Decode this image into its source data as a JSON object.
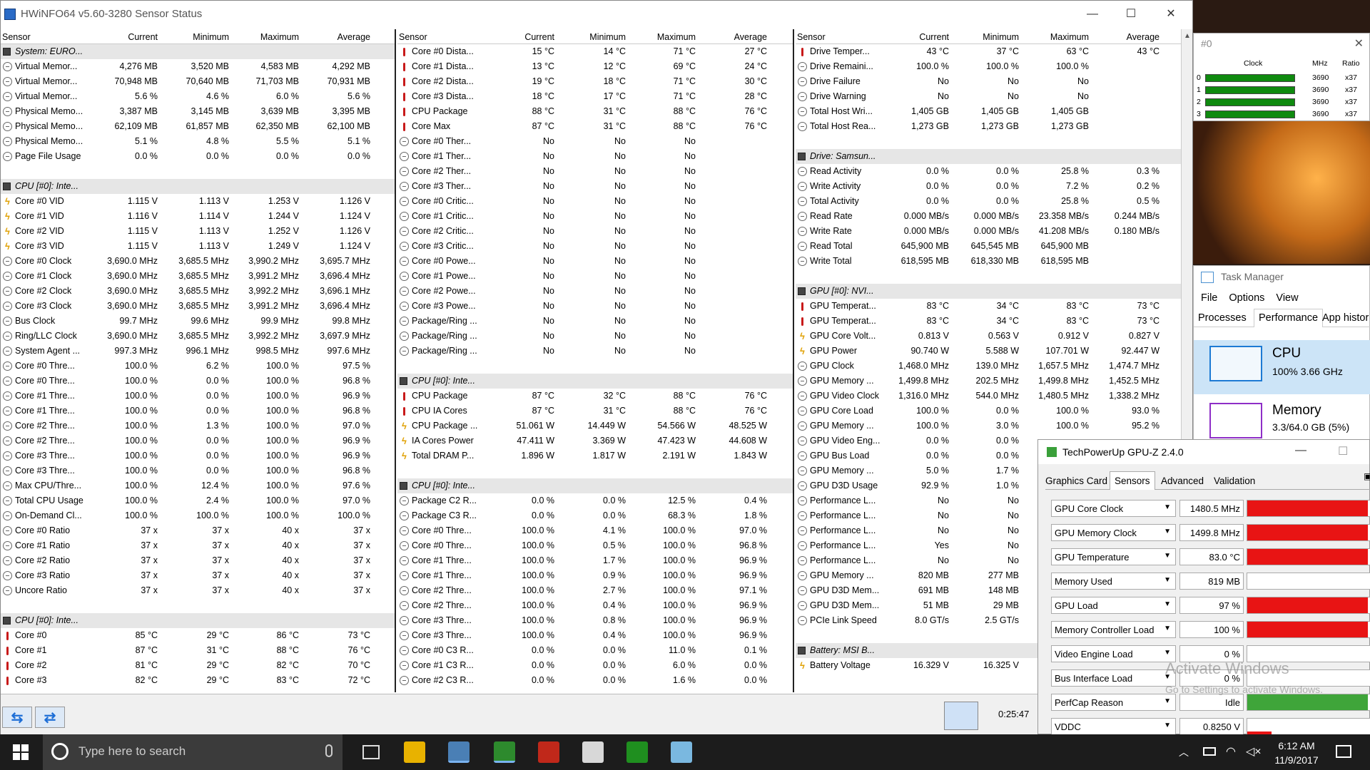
{
  "window": {
    "title": "HWiNFO64 v5.60-3280 Sensor Status",
    "minimize": "—",
    "maximize": "☐",
    "close": "✕"
  },
  "headers": {
    "sensor": "Sensor",
    "current": "Current",
    "minimum": "Minimum",
    "maximum": "Maximum",
    "average": "Average"
  },
  "col1": [
    {
      "t": "grp",
      "n": "System: EURO..."
    },
    {
      "i": "circ",
      "n": "Virtual Memor...",
      "c": "4,276 MB",
      "mn": "3,520 MB",
      "mx": "4,583 MB",
      "av": "4,292 MB"
    },
    {
      "i": "circ",
      "n": "Virtual Memor...",
      "c": "70,948 MB",
      "mn": "70,640 MB",
      "mx": "71,703 MB",
      "av": "70,931 MB"
    },
    {
      "i": "circ",
      "n": "Virtual Memor...",
      "c": "5.6 %",
      "mn": "4.6 %",
      "mx": "6.0 %",
      "av": "5.6 %"
    },
    {
      "i": "circ",
      "n": "Physical Memo...",
      "c": "3,387 MB",
      "mn": "3,145 MB",
      "mx": "3,639 MB",
      "av": "3,395 MB"
    },
    {
      "i": "circ",
      "n": "Physical Memo...",
      "c": "62,109 MB",
      "mn": "61,857 MB",
      "mx": "62,350 MB",
      "av": "62,100 MB"
    },
    {
      "i": "circ",
      "n": "Physical Memo...",
      "c": "5.1 %",
      "mn": "4.8 %",
      "mx": "5.5 %",
      "av": "5.1 %"
    },
    {
      "i": "circ",
      "n": "Page File Usage",
      "c": "0.0 %",
      "mn": "0.0 %",
      "mx": "0.0 %",
      "av": "0.0 %"
    },
    {
      "t": "blank"
    },
    {
      "t": "grp",
      "n": "CPU [#0]: Inte..."
    },
    {
      "i": "bolt",
      "n": "Core #0 VID",
      "c": "1.115 V",
      "mn": "1.113 V",
      "mx": "1.253 V",
      "av": "1.126 V"
    },
    {
      "i": "bolt",
      "n": "Core #1 VID",
      "c": "1.116 V",
      "mn": "1.114 V",
      "mx": "1.244 V",
      "av": "1.124 V"
    },
    {
      "i": "bolt",
      "n": "Core #2 VID",
      "c": "1.115 V",
      "mn": "1.113 V",
      "mx": "1.252 V",
      "av": "1.126 V"
    },
    {
      "i": "bolt",
      "n": "Core #3 VID",
      "c": "1.115 V",
      "mn": "1.113 V",
      "mx": "1.249 V",
      "av": "1.124 V"
    },
    {
      "i": "circ",
      "n": "Core #0 Clock",
      "c": "3,690.0 MHz",
      "mn": "3,685.5 MHz",
      "mx": "3,990.2 MHz",
      "av": "3,695.7 MHz"
    },
    {
      "i": "circ",
      "n": "Core #1 Clock",
      "c": "3,690.0 MHz",
      "mn": "3,685.5 MHz",
      "mx": "3,991.2 MHz",
      "av": "3,696.4 MHz"
    },
    {
      "i": "circ",
      "n": "Core #2 Clock",
      "c": "3,690.0 MHz",
      "mn": "3,685.5 MHz",
      "mx": "3,992.2 MHz",
      "av": "3,696.1 MHz"
    },
    {
      "i": "circ",
      "n": "Core #3 Clock",
      "c": "3,690.0 MHz",
      "mn": "3,685.5 MHz",
      "mx": "3,991.2 MHz",
      "av": "3,696.4 MHz"
    },
    {
      "i": "circ",
      "n": "Bus Clock",
      "c": "99.7 MHz",
      "mn": "99.6 MHz",
      "mx": "99.9 MHz",
      "av": "99.8 MHz"
    },
    {
      "i": "circ",
      "n": "Ring/LLC Clock",
      "c": "3,690.0 MHz",
      "mn": "3,685.5 MHz",
      "mx": "3,992.2 MHz",
      "av": "3,697.9 MHz"
    },
    {
      "i": "circ",
      "n": "System Agent ...",
      "c": "997.3 MHz",
      "mn": "996.1 MHz",
      "mx": "998.5 MHz",
      "av": "997.6 MHz"
    },
    {
      "i": "circ",
      "n": "Core #0 Thre...",
      "c": "100.0 %",
      "mn": "6.2 %",
      "mx": "100.0 %",
      "av": "97.5 %"
    },
    {
      "i": "circ",
      "n": "Core #0 Thre...",
      "c": "100.0 %",
      "mn": "0.0 %",
      "mx": "100.0 %",
      "av": "96.8 %"
    },
    {
      "i": "circ",
      "n": "Core #1 Thre...",
      "c": "100.0 %",
      "mn": "0.0 %",
      "mx": "100.0 %",
      "av": "96.9 %"
    },
    {
      "i": "circ",
      "n": "Core #1 Thre...",
      "c": "100.0 %",
      "mn": "0.0 %",
      "mx": "100.0 %",
      "av": "96.8 %"
    },
    {
      "i": "circ",
      "n": "Core #2 Thre...",
      "c": "100.0 %",
      "mn": "1.3 %",
      "mx": "100.0 %",
      "av": "97.0 %"
    },
    {
      "i": "circ",
      "n": "Core #2 Thre...",
      "c": "100.0 %",
      "mn": "0.0 %",
      "mx": "100.0 %",
      "av": "96.9 %"
    },
    {
      "i": "circ",
      "n": "Core #3 Thre...",
      "c": "100.0 %",
      "mn": "0.0 %",
      "mx": "100.0 %",
      "av": "96.9 %"
    },
    {
      "i": "circ",
      "n": "Core #3 Thre...",
      "c": "100.0 %",
      "mn": "0.0 %",
      "mx": "100.0 %",
      "av": "96.8 %"
    },
    {
      "i": "circ",
      "n": "Max CPU/Thre...",
      "c": "100.0 %",
      "mn": "12.4 %",
      "mx": "100.0 %",
      "av": "97.6 %"
    },
    {
      "i": "circ",
      "n": "Total CPU Usage",
      "c": "100.0 %",
      "mn": "2.4 %",
      "mx": "100.0 %",
      "av": "97.0 %"
    },
    {
      "i": "circ",
      "n": "On-Demand Cl...",
      "c": "100.0 %",
      "mn": "100.0 %",
      "mx": "100.0 %",
      "av": "100.0 %"
    },
    {
      "i": "circ",
      "n": "Core #0 Ratio",
      "c": "37 x",
      "mn": "37 x",
      "mx": "40 x",
      "av": "37 x"
    },
    {
      "i": "circ",
      "n": "Core #1 Ratio",
      "c": "37 x",
      "mn": "37 x",
      "mx": "40 x",
      "av": "37 x"
    },
    {
      "i": "circ",
      "n": "Core #2 Ratio",
      "c": "37 x",
      "mn": "37 x",
      "mx": "40 x",
      "av": "37 x"
    },
    {
      "i": "circ",
      "n": "Core #3 Ratio",
      "c": "37 x",
      "mn": "37 x",
      "mx": "40 x",
      "av": "37 x"
    },
    {
      "i": "circ",
      "n": "Uncore Ratio",
      "c": "37 x",
      "mn": "37 x",
      "mx": "40 x",
      "av": "37 x"
    },
    {
      "t": "blank"
    },
    {
      "t": "grp",
      "n": "CPU [#0]: Inte..."
    },
    {
      "i": "therm",
      "n": "Core #0",
      "c": "85 °C",
      "mn": "29 °C",
      "mx": "86 °C",
      "av": "73 °C"
    },
    {
      "i": "therm",
      "n": "Core #1",
      "c": "87 °C",
      "mn": "31 °C",
      "mx": "88 °C",
      "av": "76 °C"
    },
    {
      "i": "therm",
      "n": "Core #2",
      "c": "81 °C",
      "mn": "29 °C",
      "mx": "82 °C",
      "av": "70 °C"
    },
    {
      "i": "therm",
      "n": "Core #3",
      "c": "82 °C",
      "mn": "29 °C",
      "mx": "83 °C",
      "av": "72 °C"
    }
  ],
  "col2": [
    {
      "i": "therm",
      "n": "Core #0 Dista...",
      "c": "15 °C",
      "mn": "14 °C",
      "mx": "71 °C",
      "av": "27 °C"
    },
    {
      "i": "therm",
      "n": "Core #1 Dista...",
      "c": "13 °C",
      "mn": "12 °C",
      "mx": "69 °C",
      "av": "24 °C"
    },
    {
      "i": "therm",
      "n": "Core #2 Dista...",
      "c": "19 °C",
      "mn": "18 °C",
      "mx": "71 °C",
      "av": "30 °C"
    },
    {
      "i": "therm",
      "n": "Core #3 Dista...",
      "c": "18 °C",
      "mn": "17 °C",
      "mx": "71 °C",
      "av": "28 °C"
    },
    {
      "i": "therm",
      "n": "CPU Package",
      "c": "88 °C",
      "mn": "31 °C",
      "mx": "88 °C",
      "av": "76 °C"
    },
    {
      "i": "therm",
      "n": "Core Max",
      "c": "87 °C",
      "mn": "31 °C",
      "mx": "88 °C",
      "av": "76 °C"
    },
    {
      "i": "circ",
      "n": "Core #0 Ther...",
      "c": "No",
      "mn": "No",
      "mx": "No",
      "av": ""
    },
    {
      "i": "circ",
      "n": "Core #1 Ther...",
      "c": "No",
      "mn": "No",
      "mx": "No",
      "av": ""
    },
    {
      "i": "circ",
      "n": "Core #2 Ther...",
      "c": "No",
      "mn": "No",
      "mx": "No",
      "av": ""
    },
    {
      "i": "circ",
      "n": "Core #3 Ther...",
      "c": "No",
      "mn": "No",
      "mx": "No",
      "av": ""
    },
    {
      "i": "circ",
      "n": "Core #0 Critic...",
      "c": "No",
      "mn": "No",
      "mx": "No",
      "av": ""
    },
    {
      "i": "circ",
      "n": "Core #1 Critic...",
      "c": "No",
      "mn": "No",
      "mx": "No",
      "av": ""
    },
    {
      "i": "circ",
      "n": "Core #2 Critic...",
      "c": "No",
      "mn": "No",
      "mx": "No",
      "av": ""
    },
    {
      "i": "circ",
      "n": "Core #3 Critic...",
      "c": "No",
      "mn": "No",
      "mx": "No",
      "av": ""
    },
    {
      "i": "circ",
      "n": "Core #0 Powe...",
      "c": "No",
      "mn": "No",
      "mx": "No",
      "av": ""
    },
    {
      "i": "circ",
      "n": "Core #1 Powe...",
      "c": "No",
      "mn": "No",
      "mx": "No",
      "av": ""
    },
    {
      "i": "circ",
      "n": "Core #2 Powe...",
      "c": "No",
      "mn": "No",
      "mx": "No",
      "av": ""
    },
    {
      "i": "circ",
      "n": "Core #3 Powe...",
      "c": "No",
      "mn": "No",
      "mx": "No",
      "av": ""
    },
    {
      "i": "circ",
      "n": "Package/Ring ...",
      "c": "No",
      "mn": "No",
      "mx": "No",
      "av": ""
    },
    {
      "i": "circ",
      "n": "Package/Ring ...",
      "c": "No",
      "mn": "No",
      "mx": "No",
      "av": ""
    },
    {
      "i": "circ",
      "n": "Package/Ring ...",
      "c": "No",
      "mn": "No",
      "mx": "No",
      "av": ""
    },
    {
      "t": "blank"
    },
    {
      "t": "grp",
      "n": "CPU [#0]: Inte..."
    },
    {
      "i": "therm",
      "n": "CPU Package",
      "c": "87 °C",
      "mn": "32 °C",
      "mx": "88 °C",
      "av": "76 °C"
    },
    {
      "i": "therm",
      "n": "CPU IA Cores",
      "c": "87 °C",
      "mn": "31 °C",
      "mx": "88 °C",
      "av": "76 °C"
    },
    {
      "i": "bolt",
      "n": "CPU Package ...",
      "c": "51.061 W",
      "mn": "14.449 W",
      "mx": "54.566 W",
      "av": "48.525 W"
    },
    {
      "i": "bolt",
      "n": "IA Cores Power",
      "c": "47.411 W",
      "mn": "3.369 W",
      "mx": "47.423 W",
      "av": "44.608 W"
    },
    {
      "i": "bolt",
      "n": "Total DRAM P...",
      "c": "1.896 W",
      "mn": "1.817 W",
      "mx": "2.191 W",
      "av": "1.843 W"
    },
    {
      "t": "blank"
    },
    {
      "t": "grp",
      "n": "CPU [#0]: Inte..."
    },
    {
      "i": "circ",
      "n": "Package C2 R...",
      "c": "0.0 %",
      "mn": "0.0 %",
      "mx": "12.5 %",
      "av": "0.4 %"
    },
    {
      "i": "circ",
      "n": "Package C3 R...",
      "c": "0.0 %",
      "mn": "0.0 %",
      "mx": "68.3 %",
      "av": "1.8 %"
    },
    {
      "i": "circ",
      "n": "Core #0 Thre...",
      "c": "100.0 %",
      "mn": "4.1 %",
      "mx": "100.0 %",
      "av": "97.0 %"
    },
    {
      "i": "circ",
      "n": "Core #0 Thre...",
      "c": "100.0 %",
      "mn": "0.5 %",
      "mx": "100.0 %",
      "av": "96.8 %"
    },
    {
      "i": "circ",
      "n": "Core #1 Thre...",
      "c": "100.0 %",
      "mn": "1.7 %",
      "mx": "100.0 %",
      "av": "96.9 %"
    },
    {
      "i": "circ",
      "n": "Core #1 Thre...",
      "c": "100.0 %",
      "mn": "0.9 %",
      "mx": "100.0 %",
      "av": "96.9 %"
    },
    {
      "i": "circ",
      "n": "Core #2 Thre...",
      "c": "100.0 %",
      "mn": "2.7 %",
      "mx": "100.0 %",
      "av": "97.1 %"
    },
    {
      "i": "circ",
      "n": "Core #2 Thre...",
      "c": "100.0 %",
      "mn": "0.4 %",
      "mx": "100.0 %",
      "av": "96.9 %"
    },
    {
      "i": "circ",
      "n": "Core #3 Thre...",
      "c": "100.0 %",
      "mn": "0.8 %",
      "mx": "100.0 %",
      "av": "96.9 %"
    },
    {
      "i": "circ",
      "n": "Core #3 Thre...",
      "c": "100.0 %",
      "mn": "0.4 %",
      "mx": "100.0 %",
      "av": "96.9 %"
    },
    {
      "i": "circ",
      "n": "Core #0 C3 R...",
      "c": "0.0 %",
      "mn": "0.0 %",
      "mx": "11.0 %",
      "av": "0.1 %"
    },
    {
      "i": "circ",
      "n": "Core #1 C3 R...",
      "c": "0.0 %",
      "mn": "0.0 %",
      "mx": "6.0 %",
      "av": "0.0 %"
    },
    {
      "i": "circ",
      "n": "Core #2 C3 R...",
      "c": "0.0 %",
      "mn": "0.0 %",
      "mx": "1.6 %",
      "av": "0.0 %"
    }
  ],
  "col3": [
    {
      "i": "therm",
      "n": "Drive Temper...",
      "c": "43 °C",
      "mn": "37 °C",
      "mx": "63 °C",
      "av": "43 °C"
    },
    {
      "i": "circ",
      "n": "Drive Remaini...",
      "c": "100.0 %",
      "mn": "100.0 %",
      "mx": "100.0 %",
      "av": ""
    },
    {
      "i": "circ",
      "n": "Drive Failure",
      "c": "No",
      "mn": "No",
      "mx": "No",
      "av": ""
    },
    {
      "i": "circ",
      "n": "Drive Warning",
      "c": "No",
      "mn": "No",
      "mx": "No",
      "av": ""
    },
    {
      "i": "circ",
      "n": "Total Host Wri...",
      "c": "1,405 GB",
      "mn": "1,405 GB",
      "mx": "1,405 GB",
      "av": ""
    },
    {
      "i": "circ",
      "n": "Total Host Rea...",
      "c": "1,273 GB",
      "mn": "1,273 GB",
      "mx": "1,273 GB",
      "av": ""
    },
    {
      "t": "blank"
    },
    {
      "t": "grp",
      "n": "Drive: Samsun..."
    },
    {
      "i": "circ",
      "n": "Read Activity",
      "c": "0.0 %",
      "mn": "0.0 %",
      "mx": "25.8 %",
      "av": "0.3 %"
    },
    {
      "i": "circ",
      "n": "Write Activity",
      "c": "0.0 %",
      "mn": "0.0 %",
      "mx": "7.2 %",
      "av": "0.2 %"
    },
    {
      "i": "circ",
      "n": "Total Activity",
      "c": "0.0 %",
      "mn": "0.0 %",
      "mx": "25.8 %",
      "av": "0.5 %"
    },
    {
      "i": "circ",
      "n": "Read Rate",
      "c": "0.000 MB/s",
      "mn": "0.000 MB/s",
      "mx": "23.358 MB/s",
      "av": "0.244 MB/s"
    },
    {
      "i": "circ",
      "n": "Write Rate",
      "c": "0.000 MB/s",
      "mn": "0.000 MB/s",
      "mx": "41.208 MB/s",
      "av": "0.180 MB/s"
    },
    {
      "i": "circ",
      "n": "Read Total",
      "c": "645,900 MB",
      "mn": "645,545 MB",
      "mx": "645,900 MB",
      "av": ""
    },
    {
      "i": "circ",
      "n": "Write Total",
      "c": "618,595 MB",
      "mn": "618,330 MB",
      "mx": "618,595 MB",
      "av": ""
    },
    {
      "t": "blank"
    },
    {
      "t": "grp",
      "n": "GPU [#0]: NVI..."
    },
    {
      "i": "therm",
      "n": "GPU Temperat...",
      "c": "83 °C",
      "mn": "34 °C",
      "mx": "83 °C",
      "av": "73 °C"
    },
    {
      "i": "therm",
      "n": "GPU Temperat...",
      "c": "83 °C",
      "mn": "34 °C",
      "mx": "83 °C",
      "av": "73 °C"
    },
    {
      "i": "bolt",
      "n": "GPU Core Volt...",
      "c": "0.813 V",
      "mn": "0.563 V",
      "mx": "0.912 V",
      "av": "0.827 V"
    },
    {
      "i": "bolt",
      "n": "GPU Power",
      "c": "90.740 W",
      "mn": "5.588 W",
      "mx": "107.701 W",
      "av": "92.447 W"
    },
    {
      "i": "circ",
      "n": "GPU Clock",
      "c": "1,468.0 MHz",
      "mn": "139.0 MHz",
      "mx": "1,657.5 MHz",
      "av": "1,474.7 MHz"
    },
    {
      "i": "circ",
      "n": "GPU Memory ...",
      "c": "1,499.8 MHz",
      "mn": "202.5 MHz",
      "mx": "1,499.8 MHz",
      "av": "1,452.5 MHz"
    },
    {
      "i": "circ",
      "n": "GPU Video Clock",
      "c": "1,316.0 MHz",
      "mn": "544.0 MHz",
      "mx": "1,480.5 MHz",
      "av": "1,338.2 MHz"
    },
    {
      "i": "circ",
      "n": "GPU Core Load",
      "c": "100.0 %",
      "mn": "0.0 %",
      "mx": "100.0 %",
      "av": "93.0 %"
    },
    {
      "i": "circ",
      "n": "GPU Memory ...",
      "c": "100.0 %",
      "mn": "3.0 %",
      "mx": "100.0 %",
      "av": "95.2 %"
    },
    {
      "i": "circ",
      "n": "GPU Video Eng...",
      "c": "0.0 %",
      "mn": "0.0 %",
      "mx": "",
      "av": ""
    },
    {
      "i": "circ",
      "n": "GPU Bus Load",
      "c": "0.0 %",
      "mn": "0.0 %",
      "mx": "",
      "av": ""
    },
    {
      "i": "circ",
      "n": "GPU Memory ...",
      "c": "5.0 %",
      "mn": "1.7 %",
      "mx": "",
      "av": ""
    },
    {
      "i": "circ",
      "n": "GPU D3D Usage",
      "c": "92.9 %",
      "mn": "1.0 %",
      "mx": "",
      "av": ""
    },
    {
      "i": "circ",
      "n": "Performance L...",
      "c": "No",
      "mn": "No",
      "mx": "",
      "av": ""
    },
    {
      "i": "circ",
      "n": "Performance L...",
      "c": "No",
      "mn": "No",
      "mx": "",
      "av": ""
    },
    {
      "i": "circ",
      "n": "Performance L...",
      "c": "No",
      "mn": "No",
      "mx": "",
      "av": ""
    },
    {
      "i": "circ",
      "n": "Performance L...",
      "c": "Yes",
      "mn": "No",
      "mx": "",
      "av": ""
    },
    {
      "i": "circ",
      "n": "Performance L...",
      "c": "No",
      "mn": "No",
      "mx": "",
      "av": ""
    },
    {
      "i": "circ",
      "n": "GPU Memory ...",
      "c": "820 MB",
      "mn": "277 MB",
      "mx": "",
      "av": ""
    },
    {
      "i": "circ",
      "n": "GPU D3D Mem...",
      "c": "691 MB",
      "mn": "148 MB",
      "mx": "",
      "av": ""
    },
    {
      "i": "circ",
      "n": "GPU D3D Mem...",
      "c": "51 MB",
      "mn": "29 MB",
      "mx": "",
      "av": ""
    },
    {
      "i": "circ",
      "n": "PCIe Link Speed",
      "c": "8.0 GT/s",
      "mn": "2.5 GT/s",
      "mx": "",
      "av": ""
    },
    {
      "t": "blank"
    },
    {
      "t": "grp",
      "n": "Battery: MSI B..."
    },
    {
      "i": "bolt",
      "n": "Battery Voltage",
      "c": "16.329 V",
      "mn": "16.325 V",
      "mx": "",
      "av": ""
    }
  ],
  "status": {
    "elapsed": "0:25:47",
    "nav_left": "⇆",
    "nav_right": "⇄"
  },
  "clockwin": {
    "title": "#0",
    "cols": {
      "clock": "Clock",
      "mhz": "MHz",
      "ratio": "Ratio"
    },
    "rows": [
      {
        "id": "0",
        "mhz": "3690",
        "ratio": "x37"
      },
      {
        "id": "1",
        "mhz": "3690",
        "ratio": "x37"
      },
      {
        "id": "2",
        "mhz": "3690",
        "ratio": "x37"
      },
      {
        "id": "3",
        "mhz": "3690",
        "ratio": "x37"
      }
    ]
  },
  "taskmgr": {
    "title": "Task Manager",
    "menu": [
      "File",
      "Options",
      "View"
    ],
    "tabs": [
      "Processes",
      "Performance",
      "App histor"
    ],
    "cpu": {
      "label": "CPU",
      "value": "100%  3.66 GHz"
    },
    "memory": {
      "label": "Memory",
      "value": "3.3/64.0 GB (5%)"
    }
  },
  "gpuz": {
    "title": "TechPowerUp GPU-Z 2.4.0",
    "tabs": [
      "Graphics Card",
      "Sensors",
      "Advanced",
      "Validation"
    ],
    "rows": [
      {
        "label": "GPU Core Clock",
        "value": "1480.5 MHz",
        "fill": 0.98,
        "color": "#e81414"
      },
      {
        "label": "GPU Memory Clock",
        "value": "1499.8 MHz",
        "fill": 0.98,
        "color": "#e81414"
      },
      {
        "label": "GPU Temperature",
        "value": "83.0 °C",
        "fill": 0.98,
        "color": "#e81414"
      },
      {
        "label": "Memory Used",
        "value": "819 MB",
        "fill": 0.0,
        "color": "#e81414"
      },
      {
        "label": "GPU Load",
        "value": "97 %",
        "fill": 0.98,
        "color": "#e81414"
      },
      {
        "label": "Memory Controller Load",
        "value": "100 %",
        "fill": 0.98,
        "color": "#e81414"
      },
      {
        "label": "Video Engine Load",
        "value": "0 %",
        "fill": 0.0,
        "color": "#e81414"
      },
      {
        "label": "Bus Interface Load",
        "value": "0 %",
        "fill": 0.0,
        "color": "#e81414"
      },
      {
        "label": "PerfCap Reason",
        "value": "Idle",
        "fill": 0.98,
        "color": "#3fa53a"
      },
      {
        "label": "VDDC",
        "value": "0.8250 V",
        "fill": 0.2,
        "color": "#e81414"
      }
    ]
  },
  "watermark": {
    "line1": "Activate Windows",
    "line2": "Go to Settings to activate Windows."
  },
  "taskbar": {
    "search": "Type here to search",
    "time": "6:12 AM",
    "date": "11/9/2017"
  }
}
